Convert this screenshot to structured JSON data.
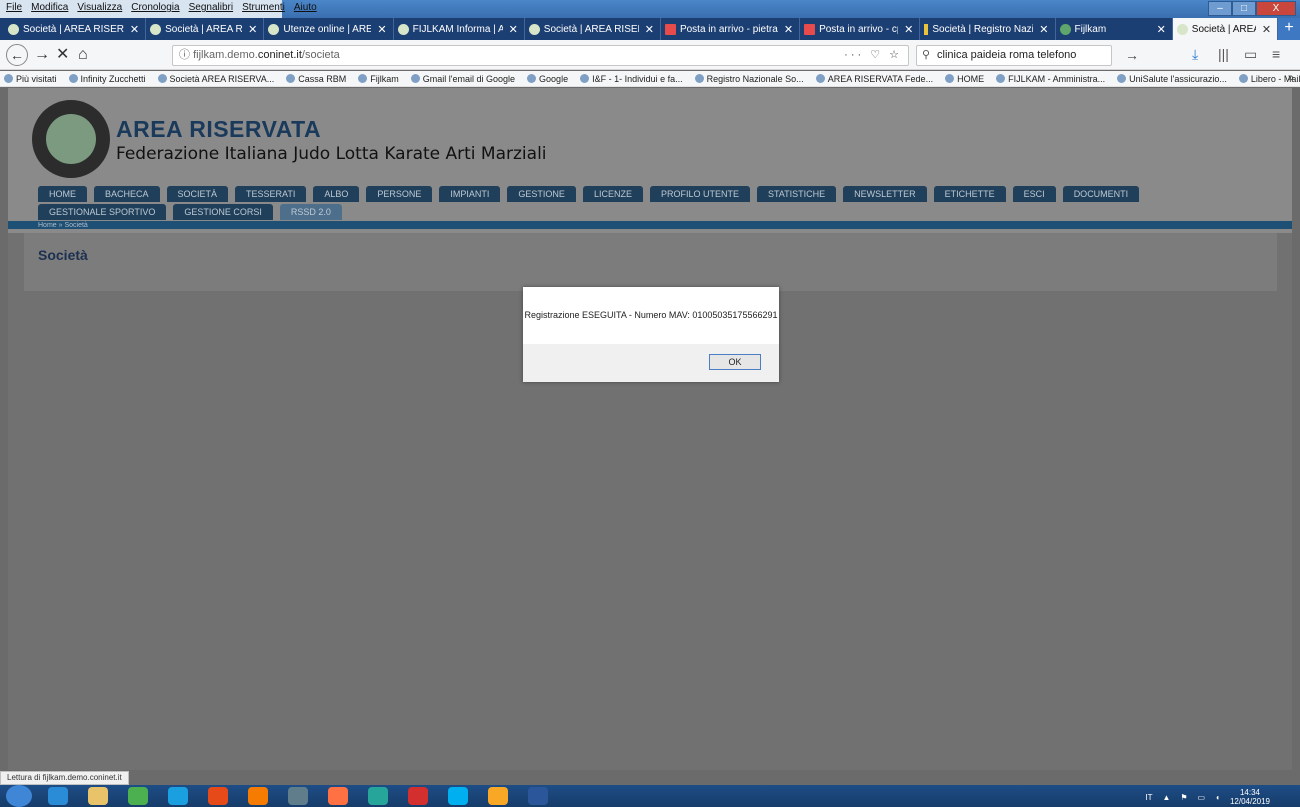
{
  "menubar": [
    "File",
    "Modifica",
    "Visualizza",
    "Cronologia",
    "Segnalibri",
    "Strumenti",
    "Aiuto"
  ],
  "window_buttons": [
    "–",
    "□",
    "X"
  ],
  "tabs": [
    {
      "title": "Società | AREA RISERVA",
      "icon": "globe-icon",
      "active": false
    },
    {
      "title": "Società | AREA RISERVA",
      "icon": "globe-icon",
      "active": false
    },
    {
      "title": "Utenze online | AREA RI",
      "icon": "globe-icon",
      "active": false
    },
    {
      "title": "FIJLKAM Informa | AREA",
      "icon": "globe-icon",
      "active": false
    },
    {
      "title": "Società | AREA RISERVA",
      "icon": "globe-icon",
      "active": false
    },
    {
      "title": "Posta in arrivo - pietran",
      "icon": "mail-icon",
      "active": false
    },
    {
      "title": "Posta in arrivo - cpietra",
      "icon": "mail-icon",
      "active": false
    },
    {
      "title": "Società | Registro Nazio",
      "icon": "flag-icon",
      "active": false
    },
    {
      "title": "Fijlkam",
      "icon": "fijlkam-icon",
      "active": false
    },
    {
      "title": "Società | AREA RISERVA",
      "icon": "globe-icon",
      "active": true
    }
  ],
  "nav": {
    "url_host": "fijlkam.demo.",
    "url_domain": "coninet.it",
    "url_path": "/societa",
    "search_value": "clinica paideia roma telefono"
  },
  "bookmarks": [
    "Più visitati",
    "Infinity Zucchetti",
    "Società AREA RISERVA...",
    "Cassa RBM",
    "Fijlkam",
    "Gmail l'email di Google",
    "Google",
    "I&F - 1- Individui e fa...",
    "Registro Nazionale So...",
    "AREA RISERVATA Fede...",
    "HOME",
    "FIJLKAM - Amministra...",
    "UniSalute l'assicurazio...",
    "Libero - Mail, Ricerca ..."
  ],
  "site": {
    "title": "AREA RISERVATA",
    "subtitle": "Federazione Italiana Judo Lotta Karate Arti Marziali",
    "menu": [
      "HOME",
      "BACHECA",
      "SOCIETÀ",
      "TESSERATI",
      "ALBO",
      "PERSONE",
      "IMPIANTI",
      "GESTIONE",
      "LICENZE",
      "PROFILO UTENTE",
      "STATISTICHE",
      "NEWSLETTER",
      "ETICHETTE",
      "ESCI",
      "DOCUMENTI",
      "GESTIONALE SPORTIVO",
      "GESTIONE CORSI",
      "RSSD 2.0"
    ],
    "active_menu": "RSSD 2.0",
    "breadcrumb": "Home » Società",
    "page_heading": "Società"
  },
  "dialog": {
    "message": "Registrazione ESEGUITA - Numero MAV: 01005035175566291",
    "ok_label": "OK"
  },
  "status_text": "Lettura di fijlkam.demo.coninet.it",
  "taskbar": {
    "lang": "IT",
    "time": "14:34",
    "date": "12/04/2019"
  }
}
